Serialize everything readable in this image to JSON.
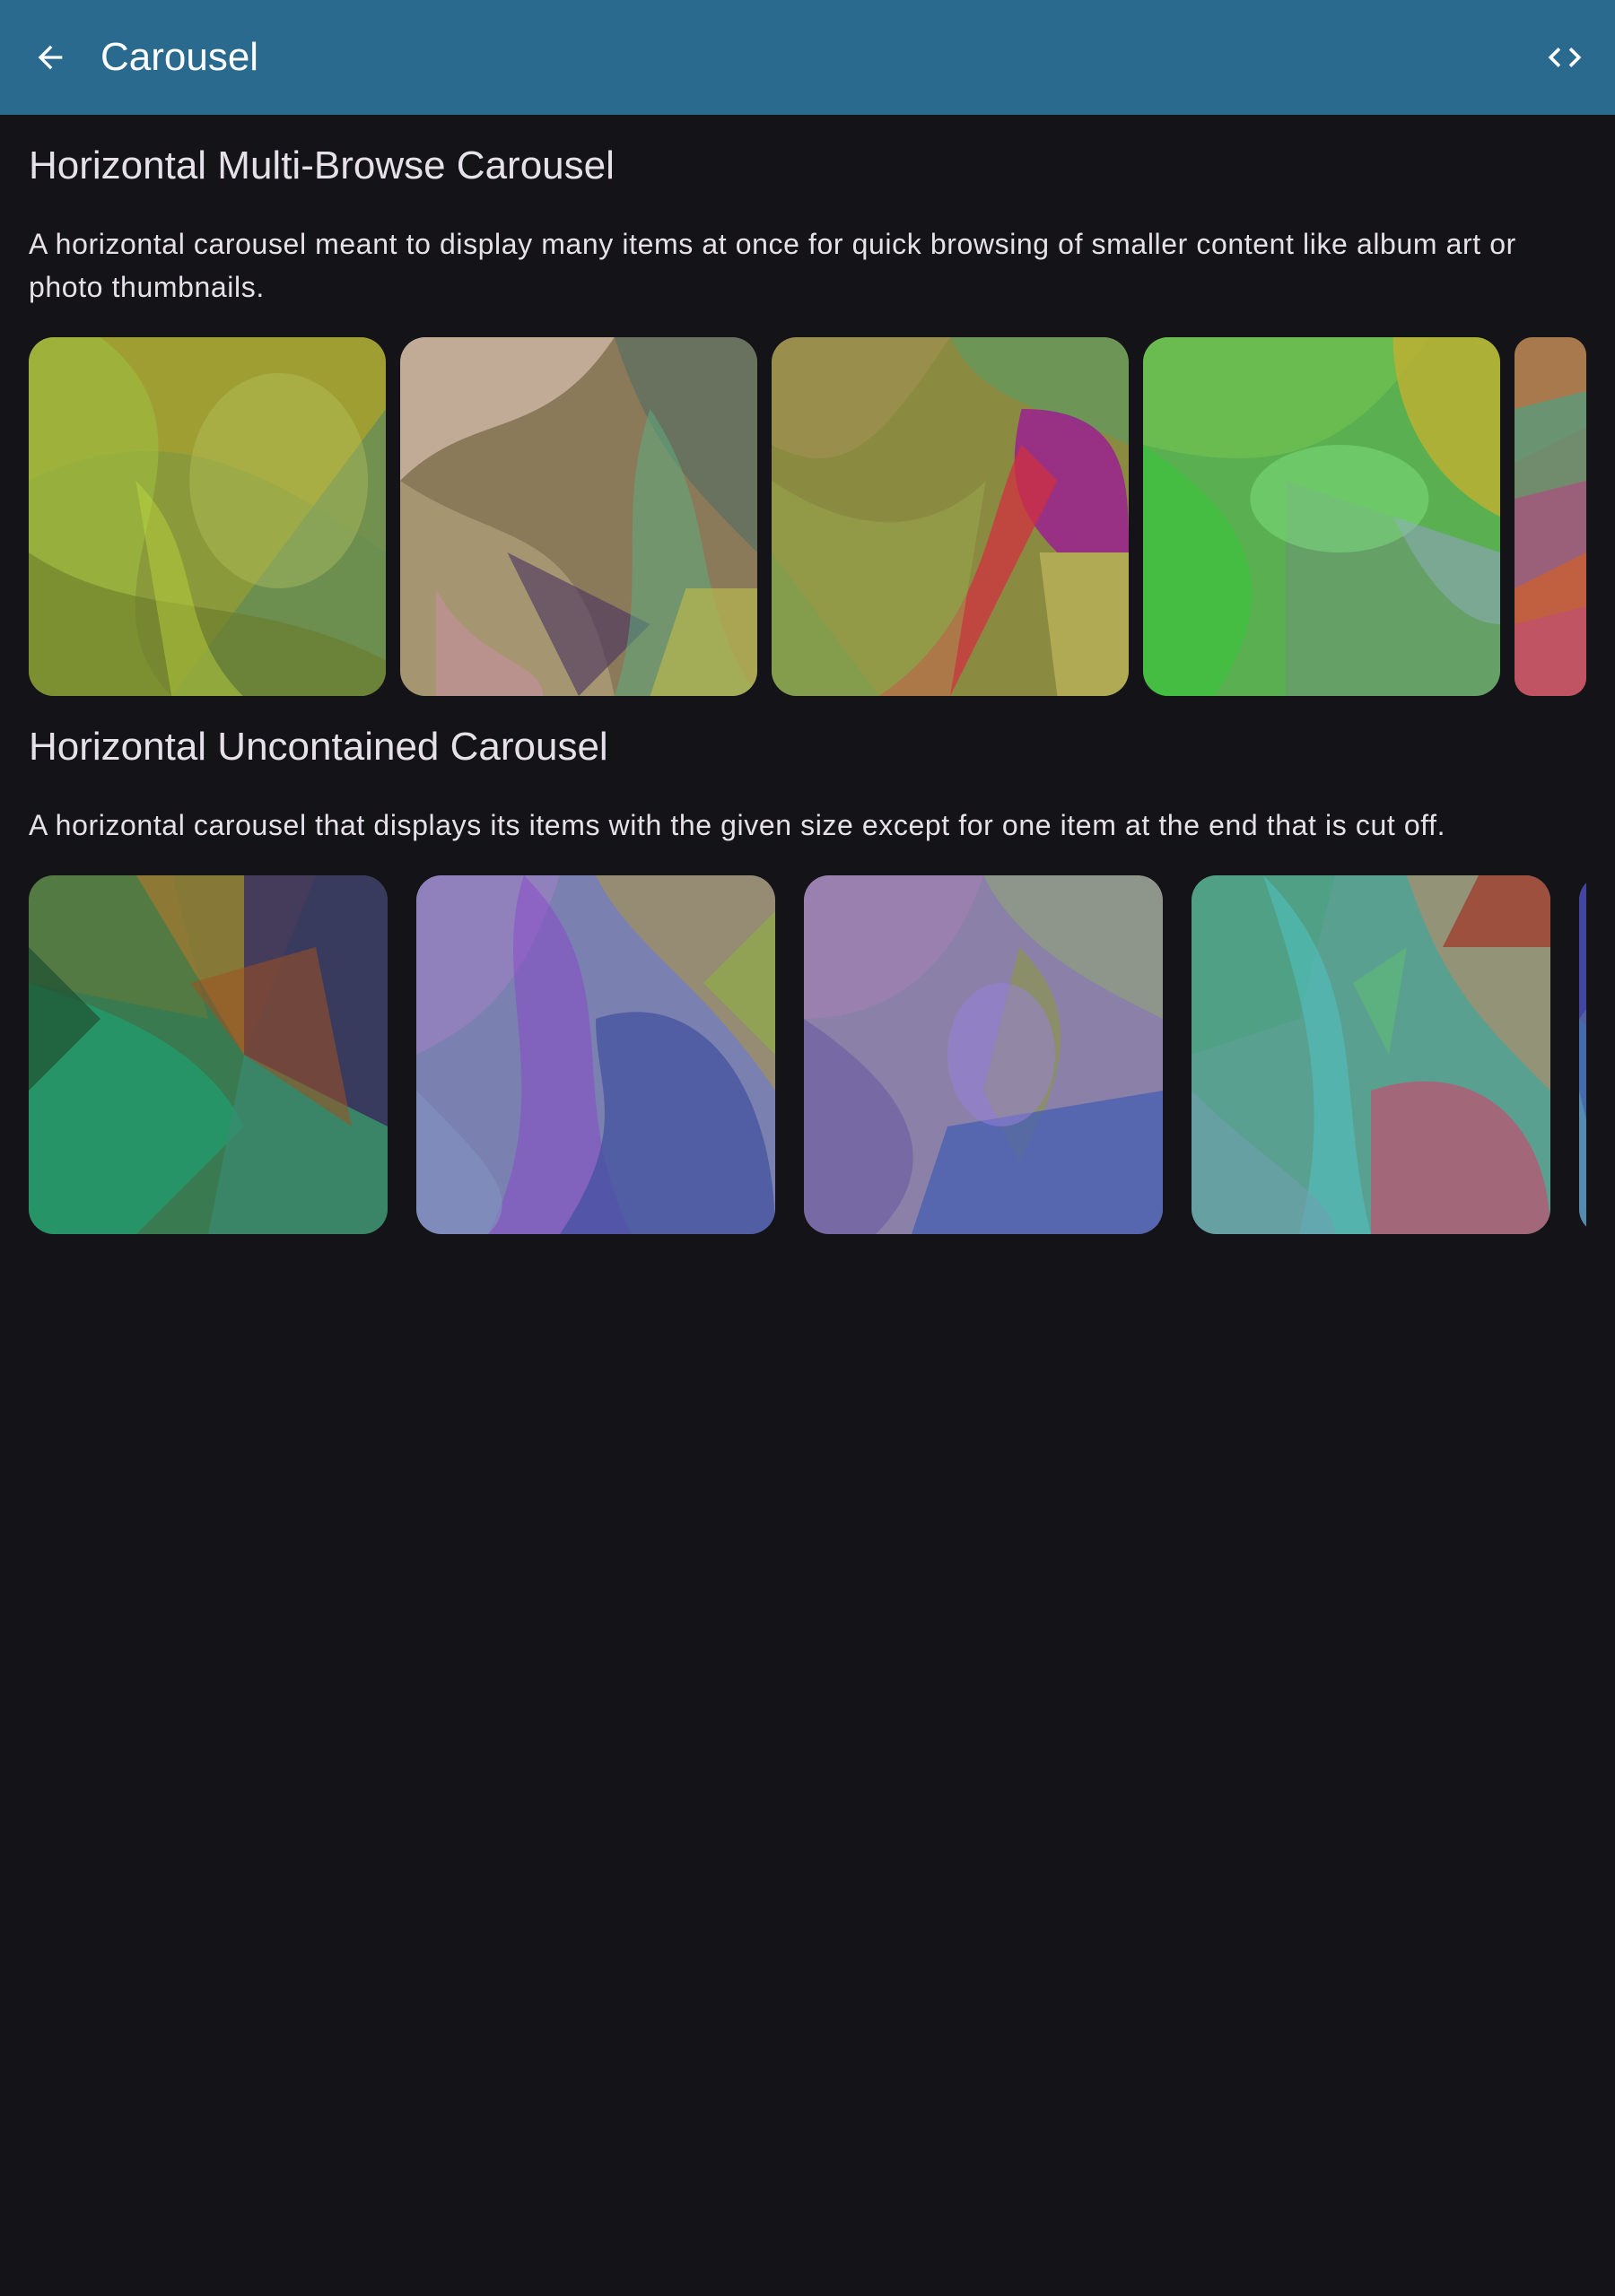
{
  "app_bar": {
    "title": "Carousel",
    "back_icon": "arrow-back-icon",
    "code_icon": "code-icon",
    "background": "#2a6a8e"
  },
  "sections": [
    {
      "title": "Horizontal Multi-Browse Carousel",
      "description": "A horizontal carousel meant to display many items at once for quick browsing of smaller content like album art or photo thumbnails."
    },
    {
      "title": "Horizontal Uncontained Carousel",
      "description": "A horizontal carousel that displays its items with the given size except for one item at the end that is cut off."
    }
  ],
  "colors": {
    "background": "#141318",
    "text": "#e6e1e9"
  }
}
